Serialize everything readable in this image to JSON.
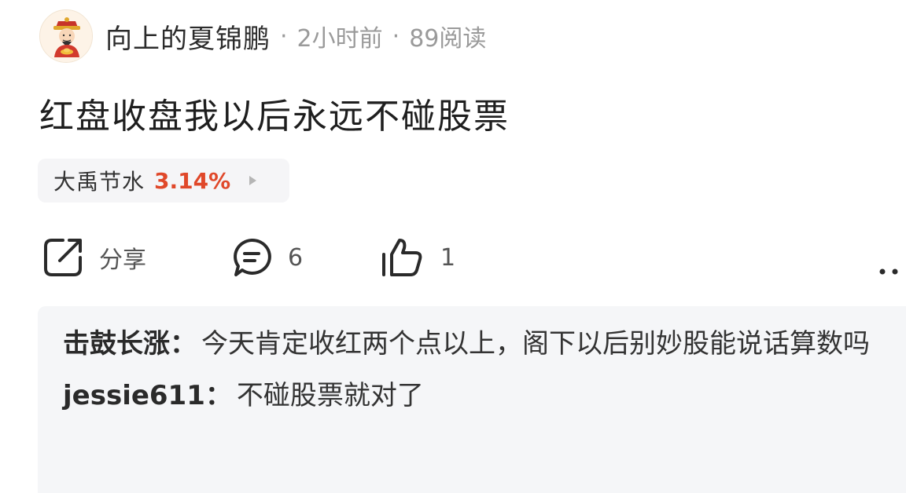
{
  "post": {
    "author": "向上的夏锦鹏",
    "time": "2小时前",
    "reads": "89阅读",
    "separator": "·",
    "title": "红盘收盘我以后永远不碰股票"
  },
  "stock": {
    "name": "大禹节水",
    "change": "3.14%",
    "change_color": "#e0482a"
  },
  "actions": {
    "share_label": "分享",
    "comment_count": "6",
    "like_count": "1"
  },
  "comments": [
    {
      "user": "击鼓长涨",
      "colon": "：",
      "text": "今天肯定收红两个点以上，阁下以后别妙股能说话算数吗"
    },
    {
      "user": "jessie611",
      "colon": "：",
      "text": "不碰股票就对了"
    }
  ],
  "icons": {
    "avatar": "caishen-avatar",
    "share": "share-icon",
    "comment": "comment-icon",
    "like": "thumbs-up-icon",
    "more": "more-dots-icon"
  }
}
